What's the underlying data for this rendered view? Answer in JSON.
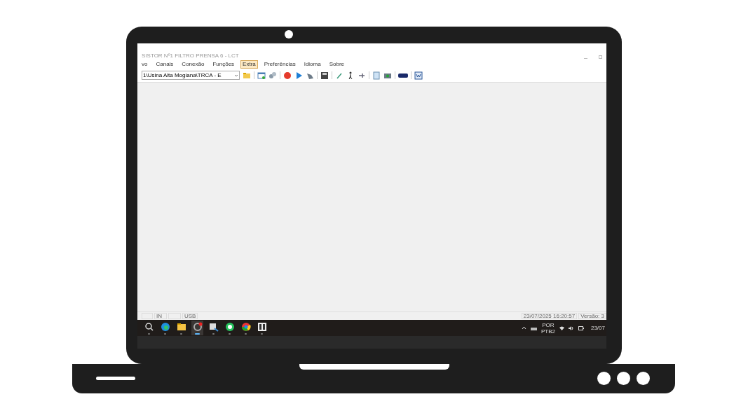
{
  "window": {
    "title": "SISTOR Nº1 FILTRO PRENSA 6 - LCT"
  },
  "menu": [
    {
      "label": "vo",
      "selected": false
    },
    {
      "label": "Canais",
      "selected": false
    },
    {
      "label": "Conexão",
      "selected": false
    },
    {
      "label": "Funções",
      "selected": false
    },
    {
      "label": "Extra",
      "selected": true
    },
    {
      "label": "Preferências",
      "selected": false
    },
    {
      "label": "Idioma",
      "selected": false
    },
    {
      "label": "Sobre",
      "selected": false
    }
  ],
  "toolbar": {
    "path_combo": "1\\Usina Alta Mogiana\\TRCA - E"
  },
  "status_bar": {
    "fields": [
      "IN",
      "USB"
    ],
    "datetime": "23/07/2025 16:20:57",
    "version": "Versão: 3"
  },
  "taskbar": {
    "apps": [
      {
        "kind": "search",
        "active": false
      },
      {
        "kind": "browser",
        "active": false
      },
      {
        "kind": "folder",
        "active": false
      },
      {
        "kind": "gauge",
        "active": true
      },
      {
        "kind": "snip",
        "active": false
      },
      {
        "kind": "chat",
        "active": false
      },
      {
        "kind": "chrome",
        "active": false
      },
      {
        "kind": "tool",
        "active": false
      }
    ],
    "language": "POR",
    "layout": "PTB2",
    "date": "23/07"
  }
}
